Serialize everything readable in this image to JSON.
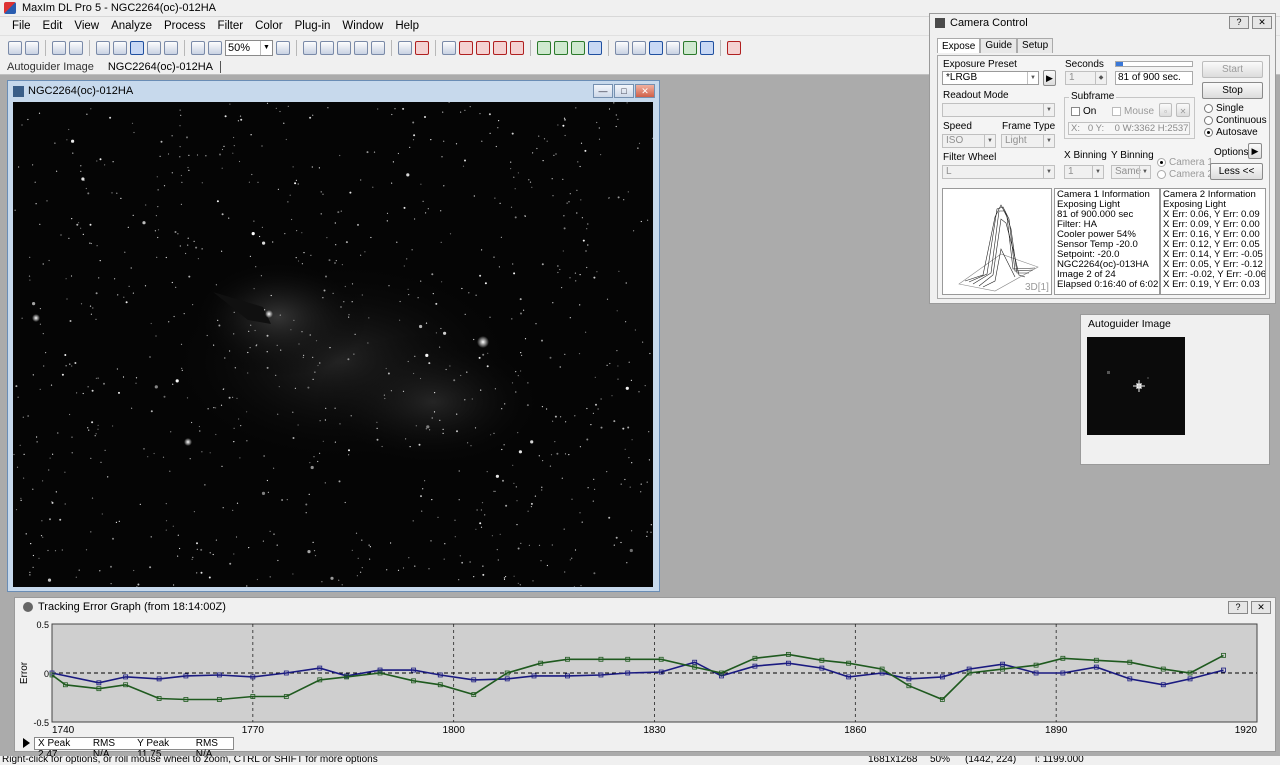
{
  "app": {
    "title": "MaxIm DL Pro 5 - NGC2264(oc)-012HA"
  },
  "menu": [
    "File",
    "Edit",
    "View",
    "Analyze",
    "Process",
    "Filter",
    "Color",
    "Plug-in",
    "Window",
    "Help"
  ],
  "toolbar": {
    "zoom_value": "50%"
  },
  "tabs": [
    "Autoguider Image",
    "NGC2264(oc)-012HA"
  ],
  "image_window": {
    "title": "NGC2264(oc)-012HA"
  },
  "camera": {
    "title": "Camera Control",
    "tabs": [
      "Expose",
      "Guide",
      "Setup"
    ],
    "exposure_preset_label": "Exposure Preset",
    "exposure_preset_value": "*LRGB",
    "seconds_label": "Seconds",
    "seconds_value": "1",
    "progress_text": "81 of 900 sec.",
    "progress_fraction": 0.09,
    "readout_mode_label": "Readout Mode",
    "subframe_label": "Subframe",
    "on_label": "On",
    "mouse_label": "Mouse",
    "subframe_coords": "X:   0 Y:    0 W:3362 H:2537",
    "speed_label": "Speed",
    "speed_value": "ISO",
    "frame_type_label": "Frame Type",
    "frame_type_value": "Light",
    "filter_wheel_label": "Filter Wheel",
    "filter_value": "L",
    "xbin_label": "X Binning",
    "xbin_value": "1",
    "ybin_label": "Y Binning",
    "ybin_value": "Same",
    "cam1_radio": "Camera 1",
    "cam2_radio": "Camera 2",
    "start_button": "Start",
    "stop_button": "Stop",
    "single_label": "Single",
    "continuous_label": "Continuous",
    "autosave_label": "Autosave",
    "options_label": "Options",
    "less_label": "Less <<",
    "plot_tag": "3D[1]",
    "cam1_info": [
      "Camera 1 Information",
      "Exposing Light",
      "81 of 900.000 sec",
      "Filter: HA",
      "Cooler power 54%",
      "Sensor Temp -20.0",
      "Setpoint: -20.0",
      "NGC2264(oc)-013HA",
      "Image 2 of 24",
      "Elapsed 0:16:40 of 6:02:00"
    ],
    "cam2_info": [
      "Camera 2 Information",
      "Exposing Light",
      "X Err: 0.06, Y Err: 0.09",
      "X Err: 0.09, Y Err: 0.00",
      "X Err: 0.16, Y Err: 0.00",
      "X Err: 0.12, Y Err: 0.05",
      "X Err: 0.14, Y Err: -0.05",
      "X Err: 0.05, Y Err: -0.12",
      "X Err: -0.02, Y Err: -0.06",
      "X Err: 0.19, Y Err: 0.03"
    ]
  },
  "autoguider": {
    "title": "Autoguider Image"
  },
  "tracking": {
    "title": "Tracking Error Graph (from 18:14:00Z)",
    "x_peak": "X Peak 2.47",
    "x_rms": "RMS N/A",
    "y_peak": "Y Peak 11.75",
    "y_rms": "RMS N/A"
  },
  "chart_data": {
    "type": "line",
    "xlabel": "",
    "ylabel": "Error",
    "xlim": [
      1740,
      1920
    ],
    "ylim": [
      -0.5,
      0.5
    ],
    "x_ticks": [
      "1740",
      "1770",
      "1800",
      "1830",
      "1860",
      "1890",
      "1920"
    ],
    "y_ticks": [
      "0.5",
      "0",
      "-0.5"
    ],
    "grid": true,
    "colors": {
      "x_series": "#1a1a80",
      "y_series": "#1f5a1f",
      "background": "#cfcfcf"
    },
    "series": [
      {
        "key": "x",
        "x": [
          1740,
          1747,
          1751,
          1756,
          1760,
          1765,
          1770,
          1775,
          1780,
          1784,
          1789,
          1794,
          1798,
          1803,
          1808,
          1812,
          1817,
          1822,
          1826,
          1831,
          1836,
          1840,
          1845,
          1850,
          1855,
          1859,
          1864,
          1868,
          1873,
          1877,
          1882,
          1887,
          1891,
          1896,
          1901,
          1906,
          1910,
          1915
        ],
        "values": [
          0.0,
          -0.1,
          -0.04,
          -0.06,
          -0.03,
          -0.02,
          -0.04,
          0.0,
          0.05,
          -0.03,
          0.03,
          0.03,
          -0.02,
          -0.07,
          -0.06,
          -0.03,
          -0.03,
          -0.02,
          0.0,
          0.01,
          0.11,
          -0.03,
          0.07,
          0.1,
          0.05,
          -0.04,
          0.0,
          -0.06,
          -0.04,
          0.04,
          0.09,
          0.0,
          0.0,
          0.06,
          -0.06,
          -0.12,
          -0.06,
          0.03
        ]
      },
      {
        "key": "y",
        "x": [
          1740,
          1742,
          1747,
          1751,
          1756,
          1760,
          1765,
          1770,
          1775,
          1780,
          1784,
          1789,
          1794,
          1798,
          1803,
          1808,
          1813,
          1817,
          1822,
          1826,
          1831,
          1836,
          1840,
          1845,
          1850,
          1855,
          1859,
          1864,
          1868,
          1873,
          1877,
          1882,
          1887,
          1891,
          1896,
          1901,
          1906,
          1910,
          1915
        ],
        "values": [
          -0.02,
          -0.12,
          -0.16,
          -0.12,
          -0.26,
          -0.27,
          -0.27,
          -0.24,
          -0.24,
          -0.07,
          -0.04,
          0.0,
          -0.08,
          -0.12,
          -0.22,
          0.0,
          0.1,
          0.14,
          0.14,
          0.14,
          0.14,
          0.06,
          0.0,
          0.15,
          0.19,
          0.13,
          0.1,
          0.04,
          -0.13,
          -0.27,
          0.0,
          0.04,
          0.08,
          0.15,
          0.13,
          0.11,
          0.04,
          0.0,
          0.18
        ]
      }
    ]
  },
  "statusbar": {
    "hint": "Right-click for options, or roll mouse wheel to zoom, CTRL or SHIFT for more options",
    "dims": "1681x1268",
    "zoom": "50%",
    "coords": "(1442, 224)",
    "value": "i:  1199.000"
  }
}
